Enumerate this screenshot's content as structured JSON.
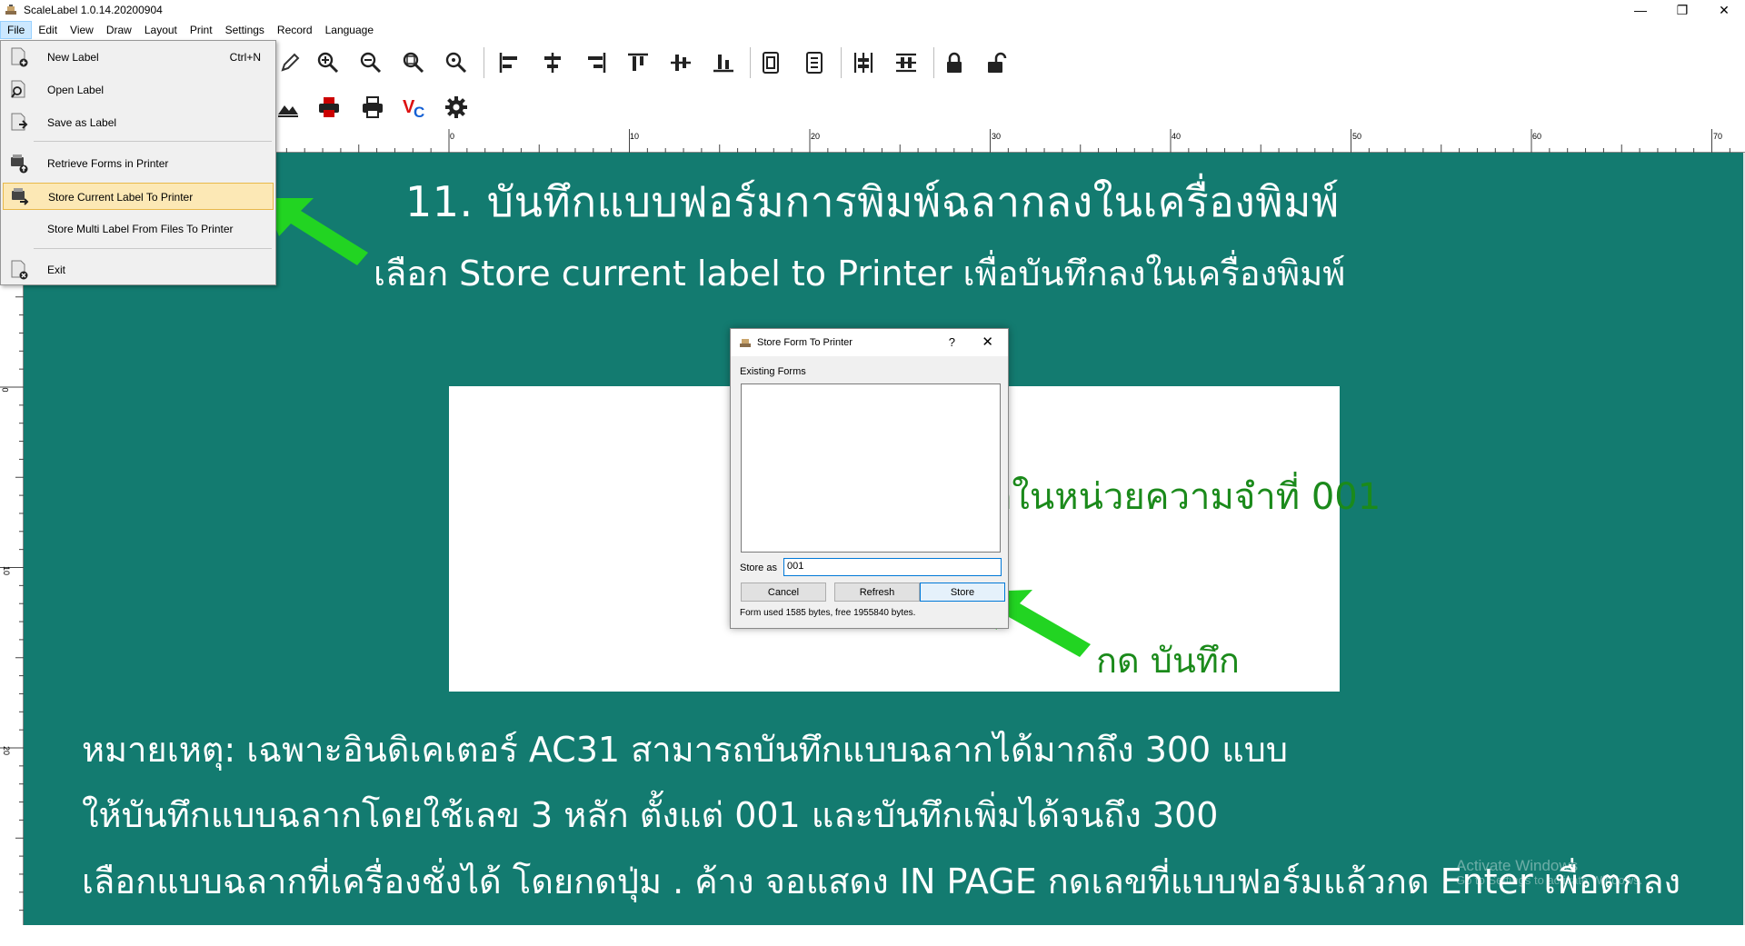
{
  "window": {
    "title": "ScaleLabel 1.0.14.20200904",
    "minimize": "—",
    "restore": "❐",
    "close": "✕"
  },
  "menubar": [
    "File",
    "Edit",
    "View",
    "Draw",
    "Layout",
    "Print",
    "Settings",
    "Record",
    "Language"
  ],
  "file_menu": {
    "new_label": "New Label",
    "new_label_shortcut": "Ctrl+N",
    "open_label": "Open Label",
    "save_as_label": "Save as Label",
    "retrieve_forms": "Retrieve Forms in Printer",
    "store_current": "Store Current Label To Printer",
    "store_multi": "Store Multi Label From Files To Printer",
    "exit": "Exit"
  },
  "ruler": {
    "h_ticks": [
      "0",
      "10",
      "20",
      "30",
      "40",
      "50",
      "60",
      "70"
    ],
    "v_ticks": [
      "0",
      "10",
      "20"
    ]
  },
  "slide": {
    "headline": "11. บันทึกแบบฟอร์มการพิมพ์ฉลากลงในเครื่องพิมพ์",
    "subline": "เลือก Store current label to Printer เพื่อบันทึกลงในเครื่องพิมพ์",
    "callout_memory": "บันทึกในหน่วยความจำที่ 001",
    "callout_press": "กด บันทึก",
    "note1": "หมายเหตุ: เฉพาะอินดิเคเตอร์ AC31 สามารถบันทึกแบบฉลากได้มากถึง 300 แบบ",
    "note2": "ให้บันทึกแบบฉลากโดยใช้เลข 3 หลัก ตั้งแต่ 001 และบันทึกเพิ่มได้จนถึง 300",
    "note3": "เลือกแบบฉลากที่เครื่องชั่งได้ โดยกดปุ่ม . ค้าง จอแสดง IN PAGE กดเลขที่แบบฟอร์มแล้วกด Enter เพื่อตกลง",
    "watermark_line1": "Activate Windows",
    "watermark_line2": "Go to Settings to activate Windows."
  },
  "dialog": {
    "title": "Store Form To Printer",
    "help": "?",
    "close": "✕",
    "existing_forms": "Existing Forms",
    "store_as_label": "Store as",
    "store_as_value": "001",
    "cancel": "Cancel",
    "refresh": "Refresh",
    "store": "Store",
    "info": "Form used 1585 bytes, free 1955840 bytes."
  },
  "colors": {
    "slide_bg": "#137b70",
    "arrow_green": "#22d422",
    "callout_green": "#1b8a1b",
    "menu_highlight": "#fce8b5"
  }
}
